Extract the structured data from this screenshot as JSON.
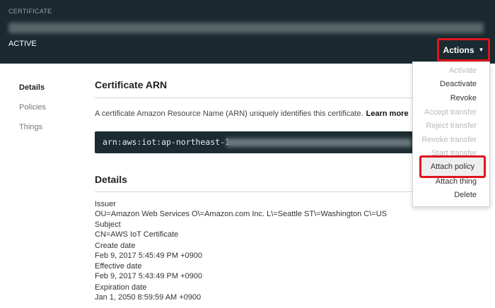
{
  "header": {
    "kicker": "CERTIFICATE",
    "status": "ACTIVE",
    "actions_label": "Actions"
  },
  "sidebar": {
    "items": [
      {
        "label": "Details",
        "active": true
      },
      {
        "label": "Policies",
        "active": false
      },
      {
        "label": "Things",
        "active": false
      }
    ]
  },
  "arn_section": {
    "title": "Certificate ARN",
    "description": "A certificate Amazon Resource Name (ARN) uniquely identifies this certificate.",
    "learn_more": "Learn more",
    "arn_value": "arn:aws:iot:ap-northeast-1:"
  },
  "details": {
    "title": "Details",
    "issuer_label": "Issuer",
    "issuer_value": "OU=Amazon Web Services O\\=Amazon.com Inc. L\\=Seattle ST\\=Washington C\\=US",
    "subject_label": "Subject",
    "subject_value": "CN=AWS IoT Certificate",
    "create_label": "Create date",
    "create_value": "Feb 9, 2017 5:45:49 PM +0900",
    "effective_label": "Effective date",
    "effective_value": "Feb 9, 2017 5:43:49 PM +0900",
    "expiration_label": "Expiration date",
    "expiration_value": "Jan 1, 2050 8:59:59 AM +0900"
  },
  "menu": {
    "items": [
      {
        "label": "Activate",
        "enabled": false
      },
      {
        "label": "Deactivate",
        "enabled": true
      },
      {
        "label": "Revoke",
        "enabled": true
      },
      {
        "label": "Accept transfer",
        "enabled": false
      },
      {
        "label": "Reject transfer",
        "enabled": false
      },
      {
        "label": "Revoke transfer",
        "enabled": false
      },
      {
        "label": "Start transfer",
        "enabled": false
      },
      {
        "label": "Attach policy",
        "enabled": true
      },
      {
        "label": "Attach thing",
        "enabled": true
      },
      {
        "label": "Delete",
        "enabled": true
      }
    ]
  },
  "colors": {
    "header_bg": "#1a2a30",
    "highlight": "#e0141e"
  }
}
